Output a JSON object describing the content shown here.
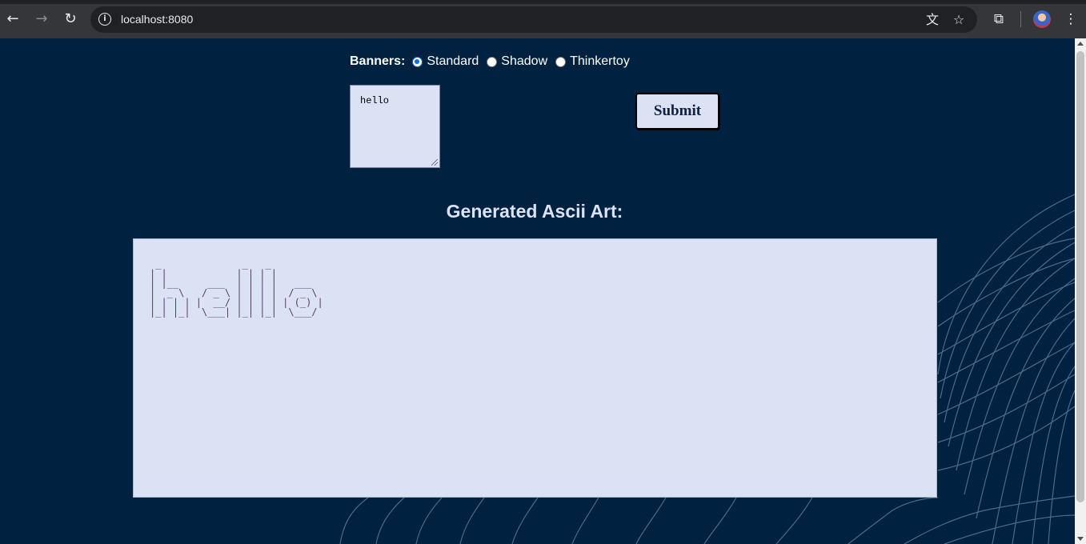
{
  "browser": {
    "url": "localhost:8080",
    "back_icon": "arrow-left-icon",
    "forward_icon": "arrow-right-icon",
    "reload_icon": "reload-icon"
  },
  "form": {
    "banners_label": "Banners:",
    "options": [
      {
        "label": "Standard",
        "checked": true
      },
      {
        "label": "Shadow",
        "checked": false
      },
      {
        "label": "Thinkertoy",
        "checked": false
      }
    ],
    "input_value": "hello",
    "submit_label": "Submit"
  },
  "output": {
    "heading": "Generated Ascii Art:",
    "ascii_art": " _              _   _          \n| |            | | | |         \n| |__     ___  | | | |   ___   \n|  _ \\   / _ \\ | | | |  / _ \\  \n| | | | |  __/ | | | | | (_) | \n|_| |_|  \\___| |_| |_|  \\___/  "
  },
  "colors": {
    "page_background": "#00213f",
    "panel_background": "#dbe2f4",
    "heading_text": "#dbe2f4",
    "radio_accent": "#0b6de0"
  }
}
